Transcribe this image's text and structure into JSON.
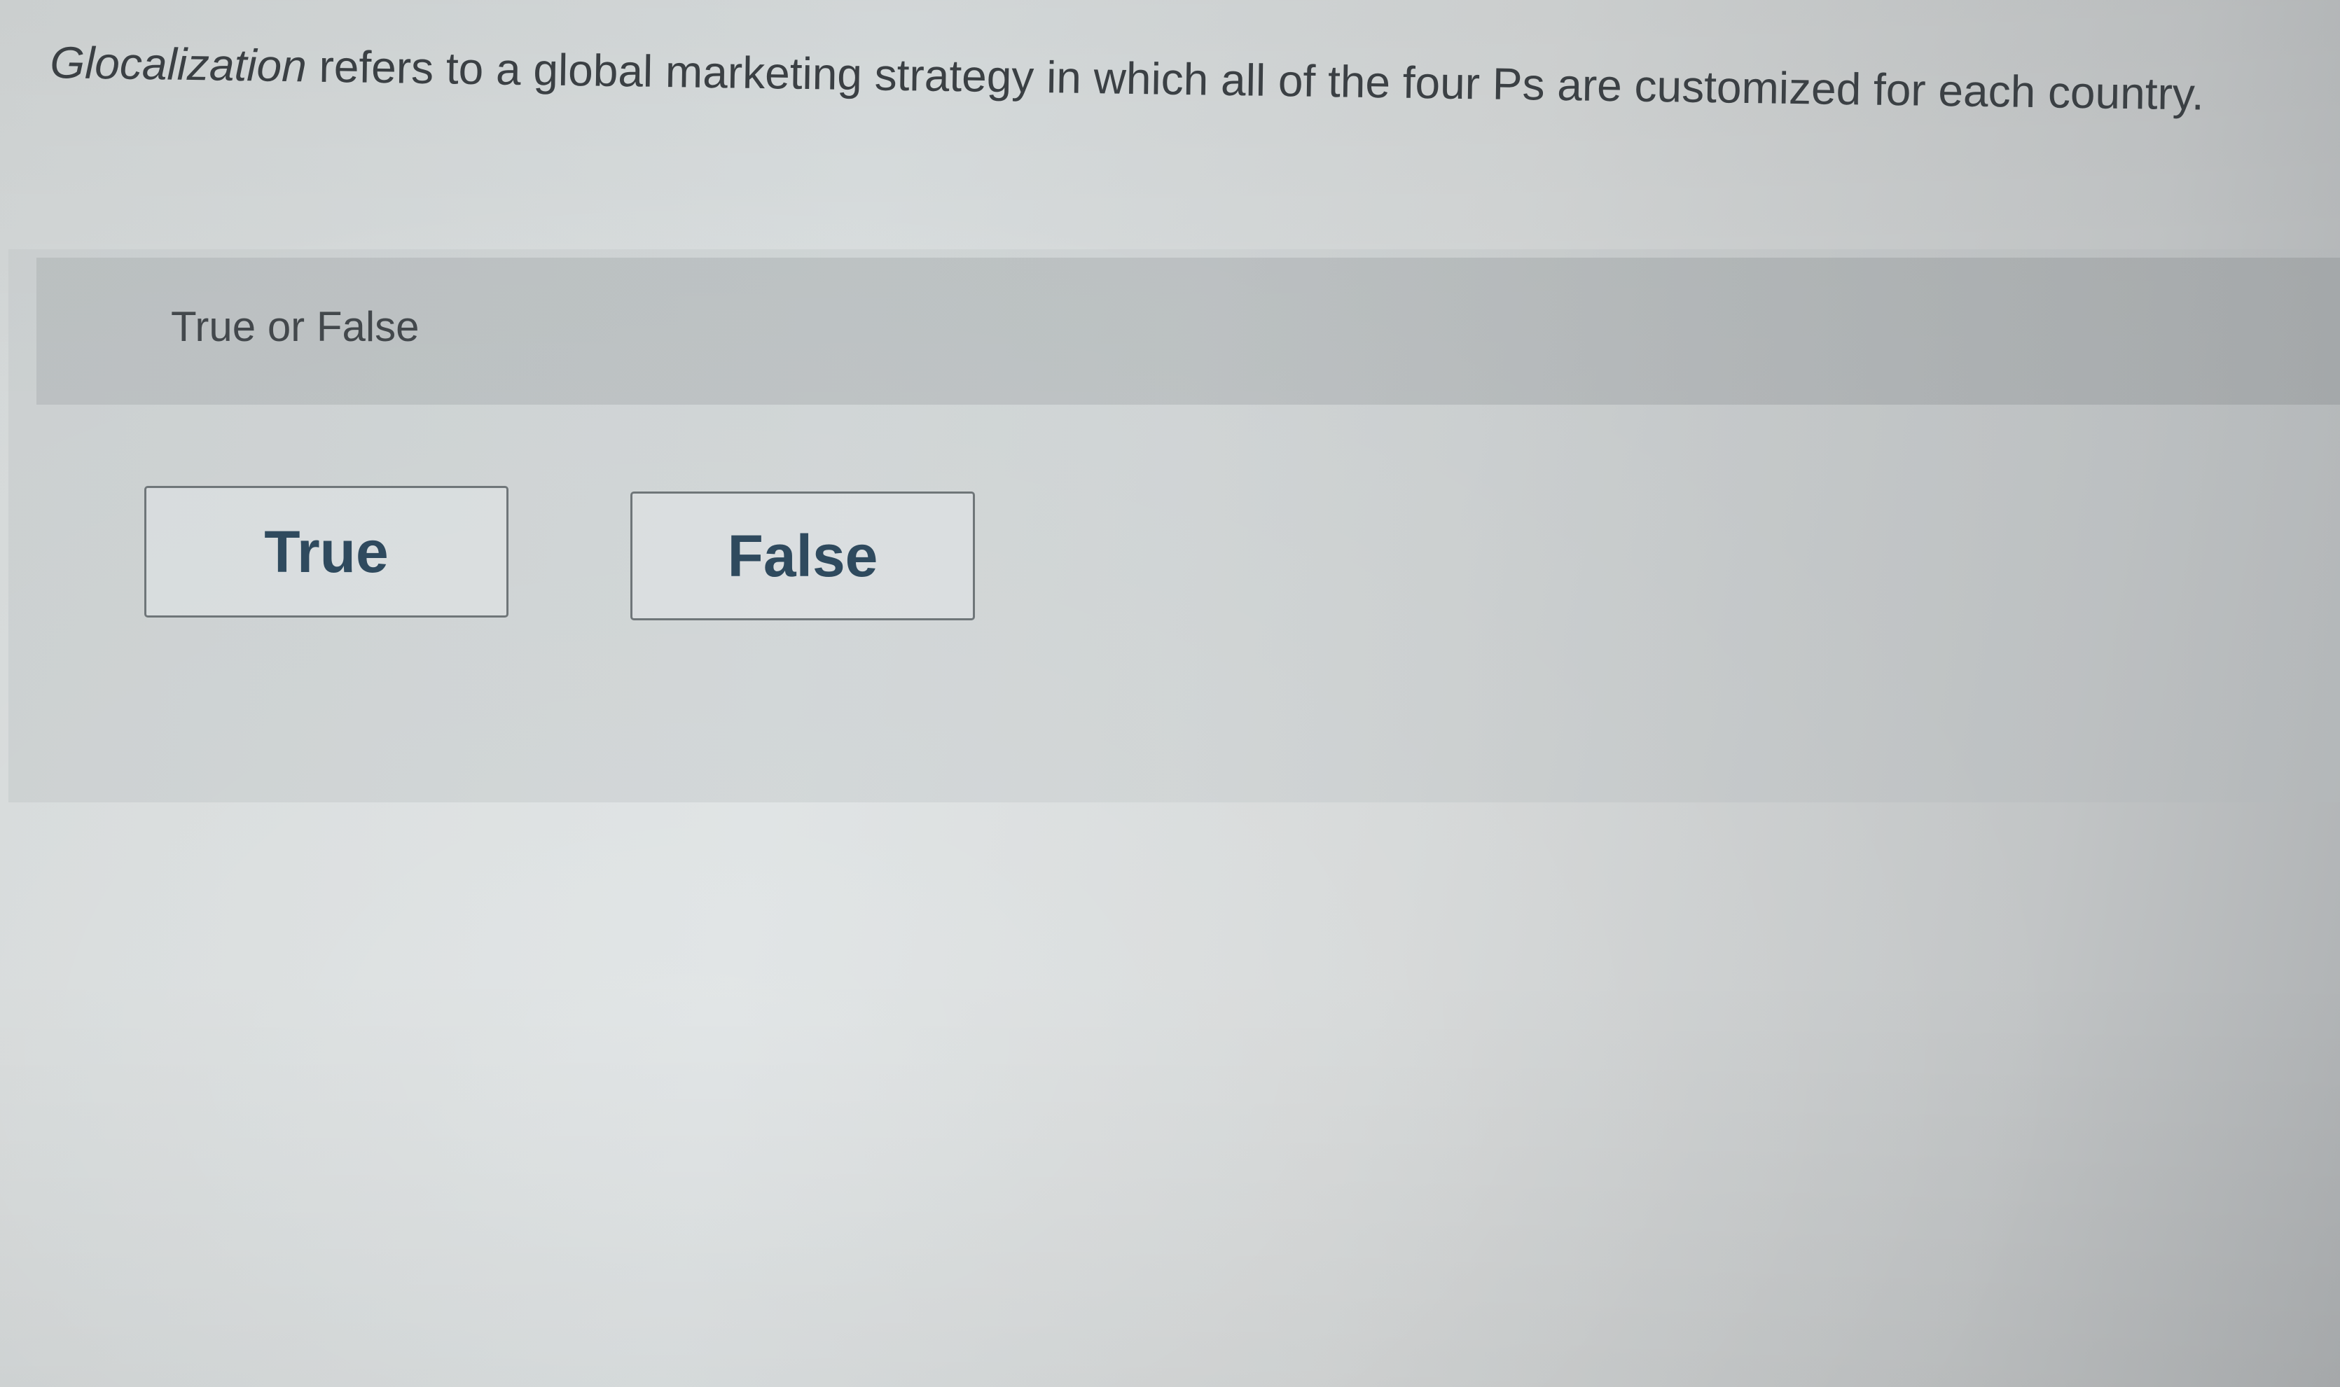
{
  "question": {
    "term": "Glocalization",
    "rest": " refers to a global marketing strategy in which all of the four Ps are customized for each country."
  },
  "question_type": "True or False",
  "answers": {
    "true_label": "True",
    "false_label": "False"
  }
}
